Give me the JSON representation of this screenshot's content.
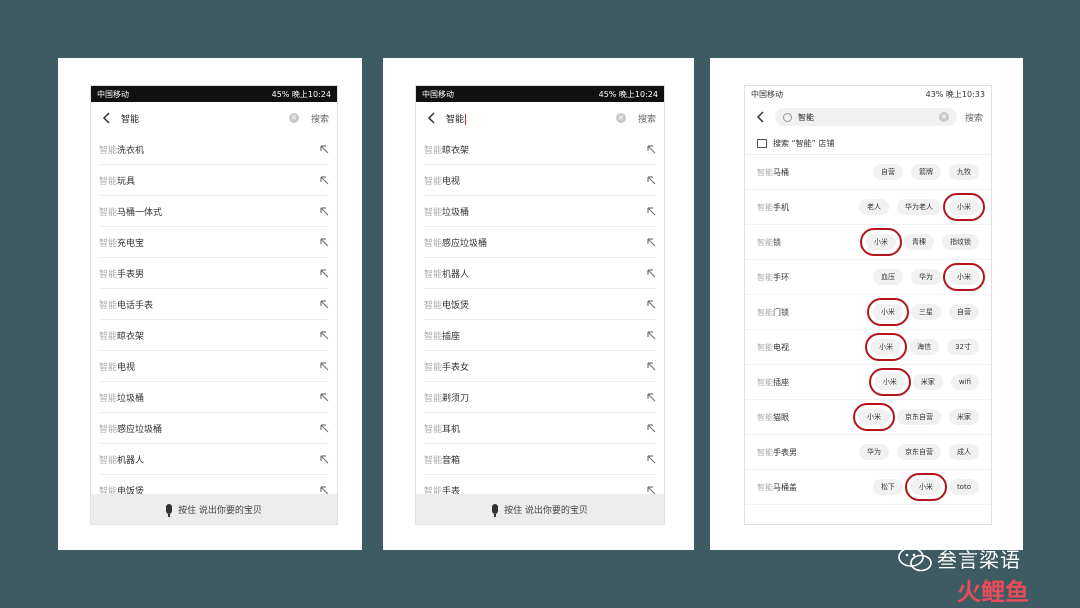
{
  "panel1": {
    "status": {
      "carrier": "中国移动",
      "right": "45%  晚上10:24"
    },
    "query": "智能",
    "search_label": "搜索",
    "prefix": "智能",
    "items": [
      "洗衣机",
      "玩具",
      "马桶一体式",
      "充电宝",
      "手表男",
      "电话手表",
      "晾衣架",
      "电视",
      "垃圾桶",
      "感应垃圾桶",
      "机器人",
      "电饭煲"
    ],
    "voice_hint": "按住 说出你要的宝贝"
  },
  "panel2": {
    "status": {
      "carrier": "中国移动",
      "right": "45%  晚上10:24"
    },
    "query": "智能",
    "search_label": "搜索",
    "prefix": "智能",
    "items": [
      "晾衣架",
      "电视",
      "垃圾桶",
      "感应垃圾桶",
      "机器人",
      "电饭煲",
      "插座",
      "手表女",
      "剃须刀",
      "耳机",
      "音箱",
      "手表"
    ],
    "voice_hint": "按住 说出你要的宝贝"
  },
  "panel3": {
    "status": {
      "carrier": "中国移动",
      "right": "43%  晚上10:33"
    },
    "query": "智能",
    "search_label": "搜索",
    "store_search": "搜索 “智能” 店铺",
    "prefix": "智能",
    "rows": [
      {
        "label": "马桶",
        "tags": [
          "自营",
          "箭牌",
          "九牧"
        ]
      },
      {
        "label": "手机",
        "tags": [
          "老人",
          "华为老人",
          "小米"
        ]
      },
      {
        "label": "锁",
        "tags": [
          "小米",
          "青稞",
          "指纹锁"
        ]
      },
      {
        "label": "手环",
        "tags": [
          "血压",
          "华为",
          "小米"
        ]
      },
      {
        "label": "门锁",
        "tags": [
          "小米",
          "三星",
          "自营"
        ]
      },
      {
        "label": "电视",
        "tags": [
          "小米",
          "海信",
          "32寸"
        ]
      },
      {
        "label": "插座",
        "tags": [
          "小米",
          "米家",
          "wifi"
        ]
      },
      {
        "label": "猫眼",
        "tags": [
          "小米",
          "京东自营",
          "米家"
        ]
      },
      {
        "label": "手表男",
        "tags": [
          "华为",
          "京东自营",
          "成人"
        ]
      },
      {
        "label": "马桶盖",
        "tags": [
          "松下",
          "小米",
          "toto"
        ]
      }
    ],
    "highlighted_tag": "小米",
    "highlight_color": "#b4141a"
  },
  "watermark": {
    "brand": "叁言梁语",
    "sub": "火鲤鱼"
  }
}
